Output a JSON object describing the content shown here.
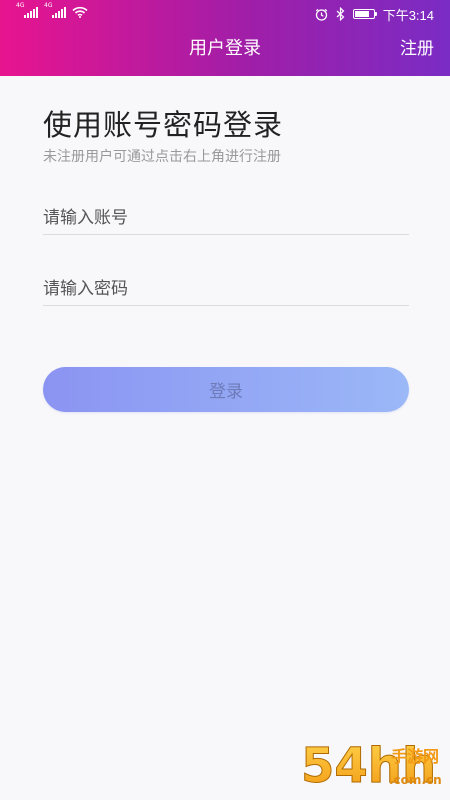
{
  "status_bar": {
    "network_labels": [
      "4G",
      "4G"
    ],
    "time": "下午3:14",
    "icons": [
      "signal-icon",
      "signal-icon",
      "wifi-icon",
      "alarm-icon",
      "bluetooth-icon",
      "battery-icon"
    ],
    "battery_level": 0.8
  },
  "nav": {
    "title": "用户登录",
    "register_label": "注册"
  },
  "main": {
    "title": "使用账号密码登录",
    "subtitle": "未注册用户可通过点击右上角进行注册"
  },
  "form": {
    "account_placeholder": "请输入账号",
    "account_value": "",
    "password_placeholder": "请输入密码",
    "password_value": "",
    "login_label": "登录"
  },
  "watermark": {
    "text": "54hh",
    "sub_text": "手游网",
    "domain": ".com.cn"
  },
  "colors": {
    "header_gradient_start": "#e8148f",
    "header_gradient_end": "#7a2cc4",
    "button_gradient_start": "#8b94f2",
    "button_gradient_end": "#9bb8f7"
  }
}
